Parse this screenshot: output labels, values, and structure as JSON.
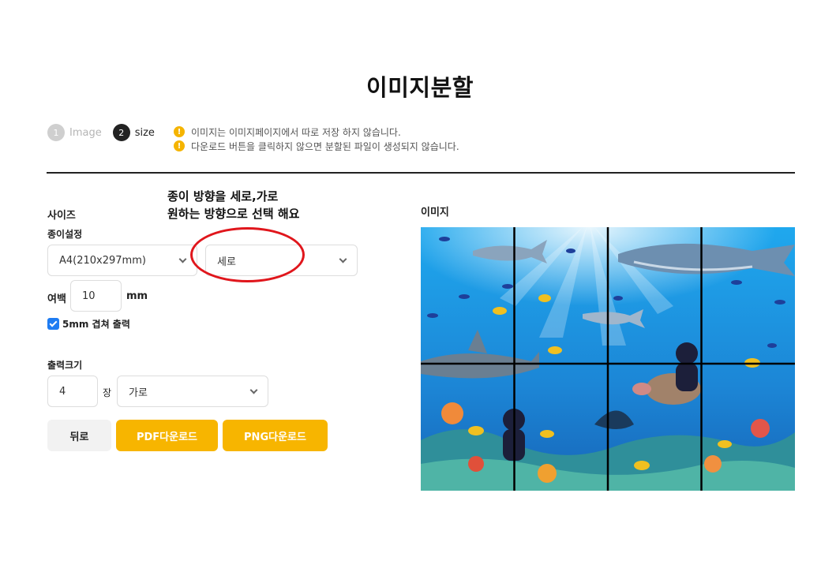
{
  "page_title": "이미지분할",
  "steps": [
    {
      "num": "1",
      "label": "Image"
    },
    {
      "num": "2",
      "label": "size"
    }
  ],
  "notices": [
    "이미지는 이미지페이지에서 따로 저장 하지 않습니다.",
    "다운로드 버튼을 클릭하지 않으면 분할된 파일이 생성되지 않습니다."
  ],
  "notice_icon_glyph": "!",
  "annotation": {
    "line1": "종이 방향을 세로,가로",
    "line2": "원하는 방향으로 선택 해요"
  },
  "size_section": {
    "title": "사이즈",
    "paper_label": "종이설정",
    "paper_size_value": "A4(210x297mm)",
    "orientation_value": "세로",
    "margin_label": "여백",
    "margin_value": "10",
    "margin_unit": "mm",
    "overlap_label": "5mm 겹쳐 출력",
    "overlap_checked": true
  },
  "output_section": {
    "title": "출력크기",
    "count_value": "4",
    "count_unit": "장",
    "direction_value": "가로"
  },
  "buttons": {
    "back": "뒤로",
    "pdf": "PDF다운로드",
    "png": "PNG다운로드"
  },
  "preview": {
    "title": "이미지",
    "grid_columns": 4,
    "grid_rows": 2
  },
  "colors": {
    "accent_yellow": "#f7b500",
    "checkbox_blue": "#1e7cf2",
    "annotation_red": "#e0161c"
  }
}
